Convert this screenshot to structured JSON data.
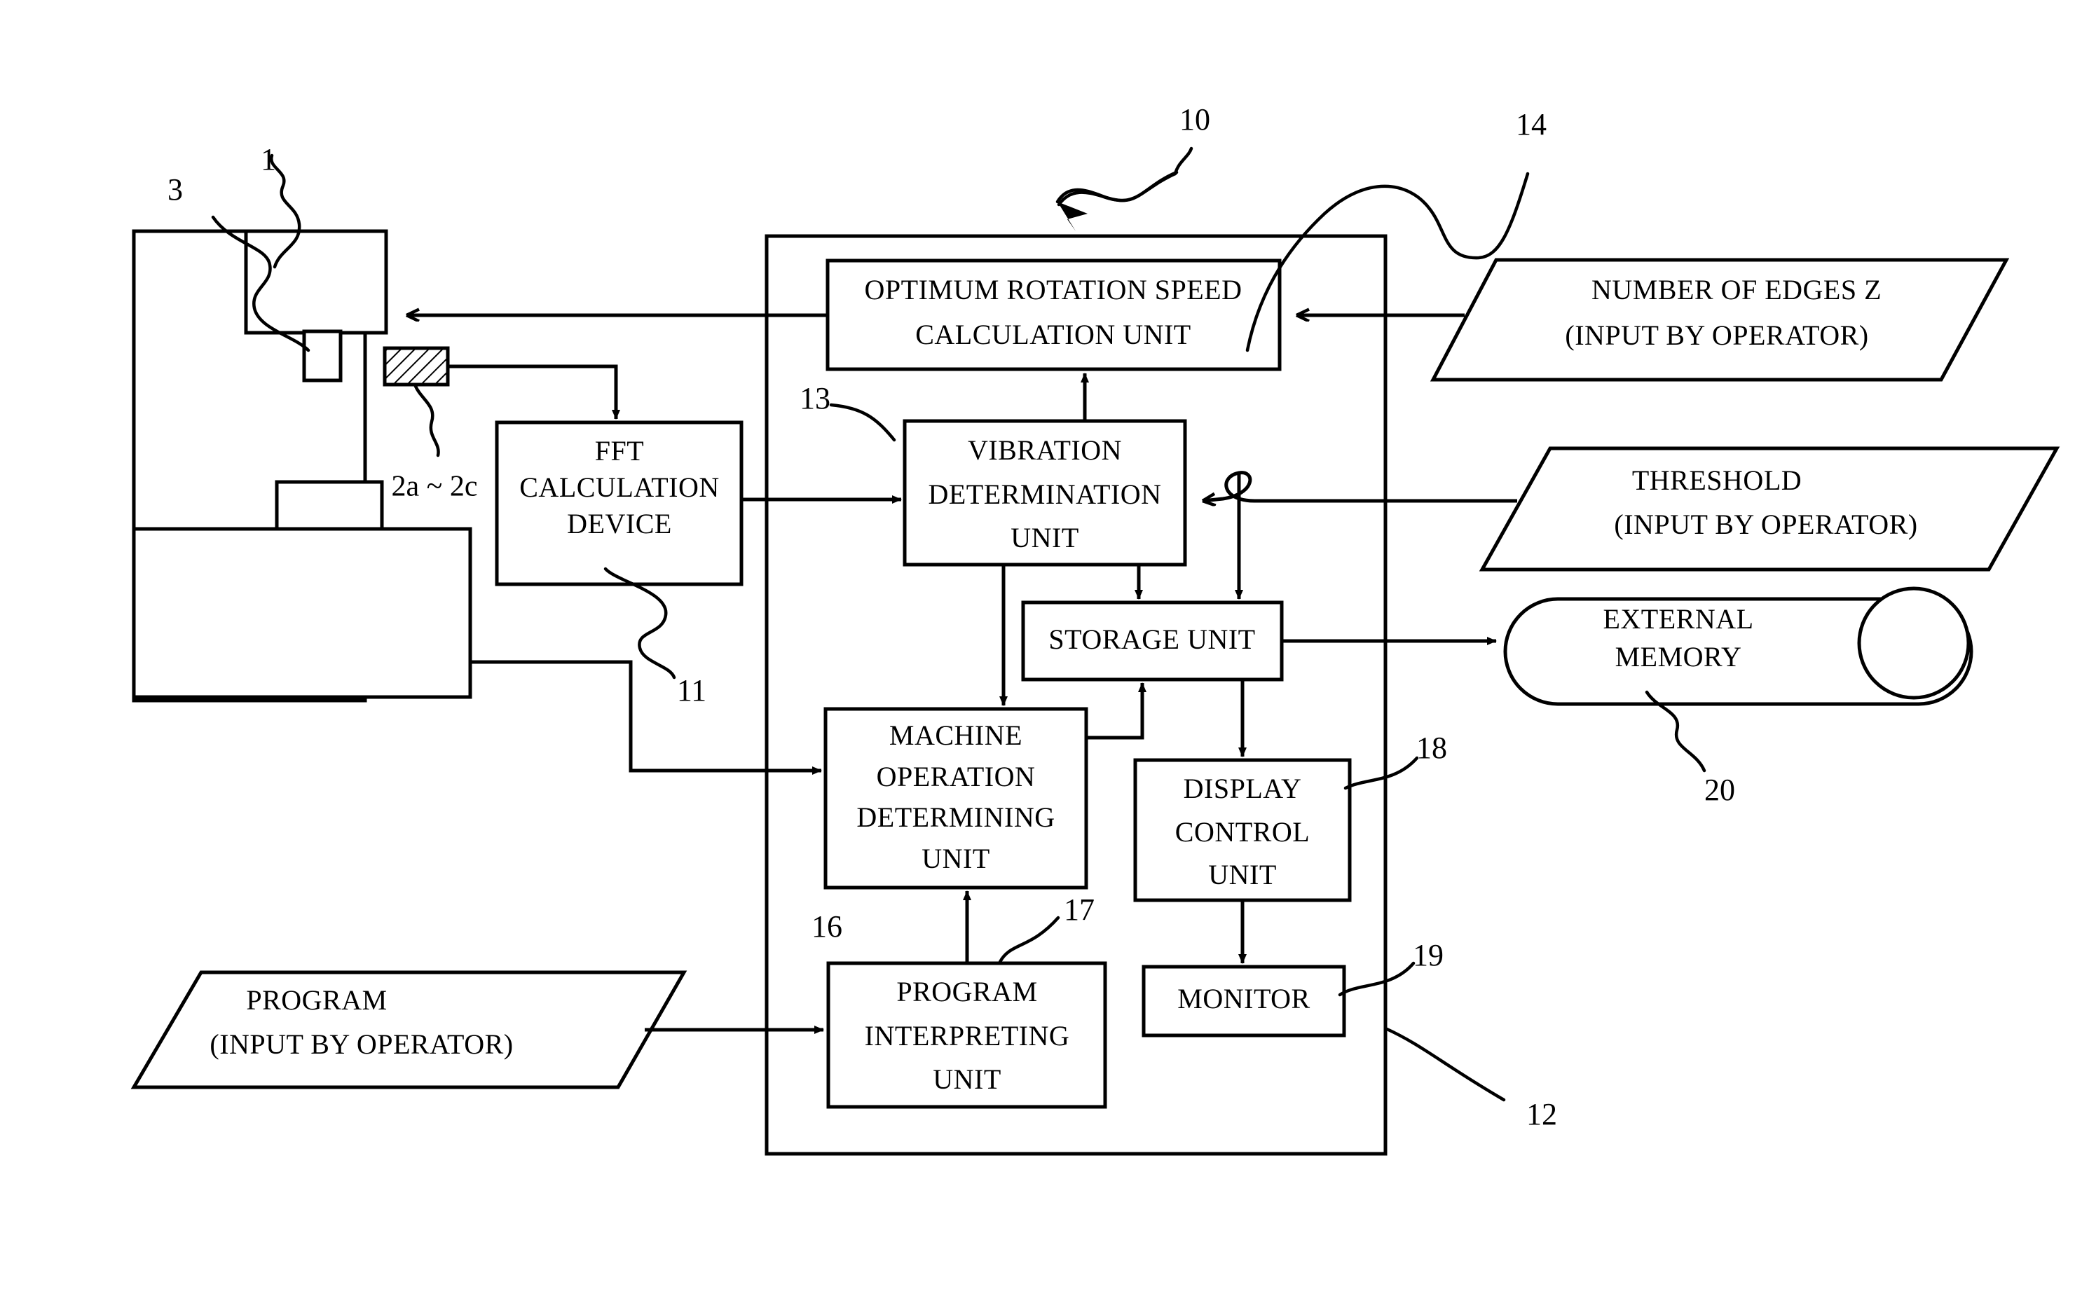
{
  "figure": {
    "title": "Machine tool vibration control block diagram",
    "line_color": "#000000",
    "fill_color": "#ffffff"
  },
  "controller": {
    "ref": "12",
    "boundary_ref_label": "12",
    "units": [
      {
        "id": "optimum-rotation-speed-calculation-unit",
        "lines": [
          "OPTIMUM ROTATION SPEED",
          "CALCULATION UNIT"
        ],
        "ref": "14"
      },
      {
        "id": "vibration-determination-unit",
        "lines": [
          "VIBRATION",
          "DETERMINATION",
          "UNIT"
        ],
        "ref": "13"
      },
      {
        "id": "storage-unit",
        "lines": [
          "STORAGE UNIT"
        ],
        "ref": ""
      },
      {
        "id": "machine-operation-determining-unit",
        "lines": [
          "MACHINE",
          "OPERATION",
          "DETERMINING",
          "UNIT"
        ],
        "ref": "16"
      },
      {
        "id": "display-control-unit",
        "lines": [
          "DISPLAY",
          "CONTROL",
          "UNIT"
        ],
        "ref": "18"
      },
      {
        "id": "monitor",
        "lines": [
          "MONITOR"
        ],
        "ref": "19"
      },
      {
        "id": "program-interpreting-unit",
        "lines": [
          "PROGRAM",
          "INTERPRETING",
          "UNIT"
        ],
        "ref": "17"
      }
    ]
  },
  "external_blocks": [
    {
      "id": "fft-calculation-device",
      "lines": [
        "FFT",
        "CALCULATION",
        "DEVICE"
      ],
      "ref": "11"
    },
    {
      "id": "external-memory",
      "lines": [
        "EXTERNAL",
        "MEMORY"
      ],
      "ref": "20"
    }
  ],
  "inputs": [
    {
      "id": "number-of-edges-z",
      "lines": [
        "NUMBER OF EDGES Z",
        "(INPUT BY OPERATOR)"
      ]
    },
    {
      "id": "threshold",
      "lines": [
        "THRESHOLD",
        "(INPUT BY OPERATOR)"
      ]
    },
    {
      "id": "program",
      "lines": [
        "PROGRAM",
        "(INPUT BY OPERATOR)"
      ]
    }
  ],
  "machine": {
    "ref_spindle": "1",
    "ref_tool": "3",
    "ref_sensors": "2a ~ 2c",
    "ref_system": "10"
  },
  "labels": {
    "optimum_l1": "OPTIMUM ROTATION SPEED",
    "optimum_l2": "CALCULATION UNIT",
    "vibration_l1": "VIBRATION",
    "vibration_l2": "DETERMINATION",
    "vibration_l3": "UNIT",
    "storage_l1": "STORAGE UNIT",
    "machineop_l1": "MACHINE",
    "machineop_l2": "OPERATION",
    "machineop_l3": "DETERMINING",
    "machineop_l4": "UNIT",
    "display_l1": "DISPLAY",
    "display_l2": "CONTROL",
    "display_l3": "UNIT",
    "monitor_l1": "MONITOR",
    "proginterp_l1": "PROGRAM",
    "proginterp_l2": "INTERPRETING",
    "proginterp_l3": "UNIT",
    "fft_l1": "FFT",
    "fft_l2": "CALCULATION",
    "fft_l3": "DEVICE",
    "extmem_l1": "EXTERNAL",
    "extmem_l2": "MEMORY",
    "edges_l1": "NUMBER OF EDGES Z",
    "edges_l2": "(INPUT BY OPERATOR)",
    "threshold_l1": "THRESHOLD",
    "threshold_l2": "(INPUT BY OPERATOR)",
    "program_l1": "PROGRAM",
    "program_l2": "(INPUT BY OPERATOR)",
    "ref_1": "1",
    "ref_2ac": "2a ~ 2c",
    "ref_3": "3",
    "ref_10": "10",
    "ref_11": "11",
    "ref_12": "12",
    "ref_13": "13",
    "ref_14": "14",
    "ref_16": "16",
    "ref_17": "17",
    "ref_18": "18",
    "ref_19": "19",
    "ref_20": "20"
  }
}
